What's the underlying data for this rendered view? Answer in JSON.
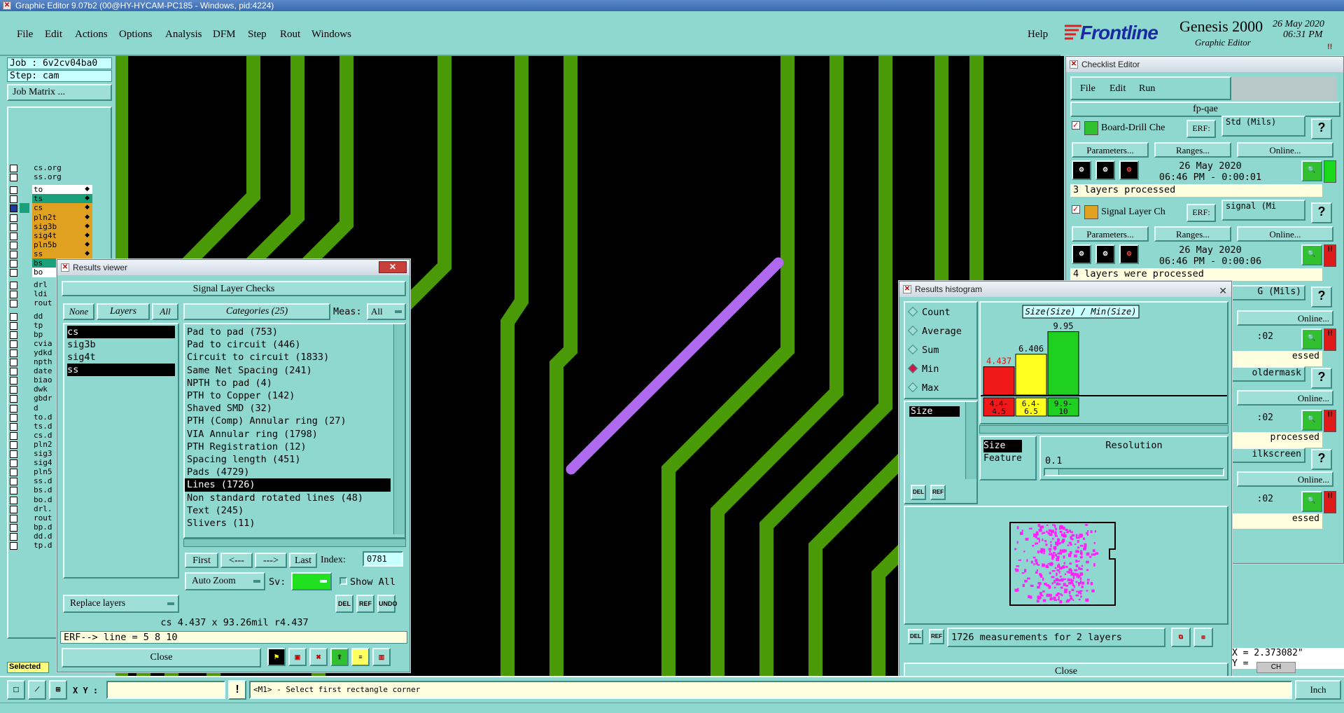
{
  "app": {
    "title": "Graphic Editor 9.07b2 (00@HY-HYCAM-PC185 - Windows, pid:4224)",
    "menu": [
      "File",
      "Edit",
      "Actions",
      "Options",
      "Analysis",
      "DFM",
      "Step",
      "Rout",
      "Windows"
    ],
    "help": "Help",
    "brand": "Frontline",
    "product": "Genesis 2000",
    "product_sub": "Graphic Editor",
    "date": "26 May 2020",
    "time": "06:31 PM"
  },
  "left_panel": {
    "job_label": "Job : 6v2cv04ba0",
    "step_label": "Step: cam",
    "job_matrix": "Job Matrix ...",
    "layers": [
      {
        "name": "cs.org",
        "color": "#8fd8d0"
      },
      {
        "name": "ss.org",
        "color": "#8fd8d0"
      },
      {
        "name": "to",
        "color": "#ffffff"
      },
      {
        "name": "ts",
        "color": "#1aa07a"
      },
      {
        "name": "cs",
        "color": "#e0a020"
      },
      {
        "name": "pln2t",
        "color": "#e0a020"
      },
      {
        "name": "sig3b",
        "color": "#e0a020"
      },
      {
        "name": "sig4t",
        "color": "#e0a020"
      },
      {
        "name": "pln5b",
        "color": "#e0a020"
      },
      {
        "name": "ss",
        "color": "#e0a020"
      },
      {
        "name": "bs",
        "color": "#1aa07a"
      },
      {
        "name": "bo",
        "color": "#ffffff"
      },
      {
        "name": "drl",
        "color": "#8fd8d0"
      },
      {
        "name": "ldi",
        "color": "#8fd8d0"
      },
      {
        "name": "rout",
        "color": "#8fd8d0"
      },
      {
        "name": "dd",
        "color": "#8fd8d0"
      },
      {
        "name": "tp",
        "color": "#8fd8d0"
      },
      {
        "name": "bp",
        "color": "#8fd8d0"
      },
      {
        "name": "cvia",
        "color": "#8fd8d0"
      },
      {
        "name": "ydkd",
        "color": "#8fd8d0"
      },
      {
        "name": "npth",
        "color": "#8fd8d0"
      },
      {
        "name": "date",
        "color": "#8fd8d0"
      },
      {
        "name": "biao",
        "color": "#8fd8d0"
      },
      {
        "name": "dwk",
        "color": "#8fd8d0"
      },
      {
        "name": "gbdr",
        "color": "#8fd8d0"
      },
      {
        "name": "d",
        "color": "#8fd8d0"
      },
      {
        "name": "to.d",
        "color": "#8fd8d0"
      },
      {
        "name": "ts.d",
        "color": "#8fd8d0"
      },
      {
        "name": "cs.d",
        "color": "#8fd8d0"
      },
      {
        "name": "pln2",
        "color": "#8fd8d0"
      },
      {
        "name": "sig3",
        "color": "#8fd8d0"
      },
      {
        "name": "sig4",
        "color": "#8fd8d0"
      },
      {
        "name": "pln5",
        "color": "#8fd8d0"
      },
      {
        "name": "ss.d",
        "color": "#8fd8d0"
      },
      {
        "name": "bs.d",
        "color": "#8fd8d0"
      },
      {
        "name": "bo.d",
        "color": "#8fd8d0"
      },
      {
        "name": "drl.",
        "color": "#8fd8d0"
      },
      {
        "name": "rout",
        "color": "#8fd8d0"
      },
      {
        "name": "bp.d",
        "color": "#8fd8d0"
      },
      {
        "name": "dd.d",
        "color": "#8fd8d0"
      },
      {
        "name": "tp.d",
        "color": "#8fd8d0"
      }
    ],
    "selected": "Selected"
  },
  "results_viewer": {
    "title": "Results viewer",
    "header": "Signal Layer Checks",
    "none_btn": "None",
    "layers_btn": "Layers",
    "all_btn": "All",
    "layers": [
      "cs",
      "sig3b",
      "sig4t",
      "ss"
    ],
    "categories_btn": "Categories (25)",
    "meas_label": "Meas:",
    "meas_value": "All",
    "categories": [
      "Pad to pad (753)",
      "Pad to circuit (446)",
      "Circuit to circuit (1833)",
      "Same Net Spacing (241)",
      "NPTH to pad (4)",
      "PTH to Copper (142)",
      "Shaved SMD (32)",
      "PTH (Comp) Annular ring (27)",
      "VIA Annular ring (1798)",
      "PTH Registration (12)",
      "Spacing length (451)",
      "Pads (4729)",
      "Lines (1726)",
      "Non standard rotated lines (48)",
      "Text (245)",
      "Slivers (11)"
    ],
    "selected_category": "Lines (1726)",
    "first": "First",
    "prev": "<---",
    "next": "--->",
    "last": "Last",
    "index_label": "Index:",
    "index_value": "0781",
    "auto_zoom": "Auto Zoom",
    "sv_label": "Sv:",
    "show_all": "Show All",
    "replace_layers": "Replace layers",
    "del": "DEL",
    "ref": "REF",
    "undo": "UNDO",
    "status": "cs 4.437 x 93.26mil  r4.437",
    "erf": "ERF--> line = 5 8 10",
    "close": "Close"
  },
  "checklist_editor": {
    "title": "Checklist Editor",
    "menu": [
      "File",
      "Edit",
      "Run"
    ],
    "name": "fp-qae",
    "checks": [
      {
        "name": "Board-Drill Che",
        "erf": "ERF:",
        "erf_value": "Std (Mils)",
        "params": "Parameters...",
        "ranges": "Ranges...",
        "online": "Online...",
        "date": "26 May 2020",
        "time": "06:46 PM - 0:00:01",
        "status": "3 layers processed",
        "status_color": "#1ad81a"
      },
      {
        "name": "Signal Layer Ch",
        "erf": "ERF:",
        "erf_value": "signal (Mi",
        "params": "Parameters...",
        "ranges": "Ranges...",
        "online": "Online...",
        "date": "26 May 2020",
        "time": "06:46 PM - 0:00:06",
        "status": "4 layers were processed",
        "status_color": "#e01a1a"
      }
    ],
    "partial": [
      "G (Mils)",
      "Online...",
      ":02",
      "essed",
      "oldermask",
      "Online...",
      ":02",
      "processed",
      "ilkscreen",
      "Online...",
      ":02",
      "essed"
    ]
  },
  "histogram": {
    "title": "Results histogram",
    "modes": [
      "Count",
      "Average",
      "Sum",
      "Min",
      "Max"
    ],
    "selected_mode": "Min",
    "chart_title": "Size(Size) / Min(Size)",
    "list_items": [
      "Size"
    ],
    "list2": [
      "Size",
      "Feature"
    ],
    "resolution_label": "Resolution",
    "resolution_value": "0.1",
    "del": "DEL",
    "ref": "REF",
    "measurements": "1726 measurements for 2 layers",
    "close": "Close"
  },
  "chart_data": {
    "type": "bar",
    "title": "Size(Size) / Min(Size)",
    "categories": [
      "4.4-4.5",
      "6.4-6.5",
      "9.9-10"
    ],
    "values": [
      4.437,
      6.406,
      9.95
    ],
    "value_labels": [
      "4.437",
      "6.406",
      "9.95"
    ],
    "category_labels": [
      [
        "4.4-",
        "4.5"
      ],
      [
        "6.4-",
        "6.5"
      ],
      [
        "9.9-",
        "10"
      ]
    ],
    "colors": [
      "#f01818",
      "#ffff20",
      "#20d020"
    ],
    "label_colors": [
      "#e01010",
      "#000000",
      "#000000"
    ],
    "ylim": [
      0,
      11
    ]
  },
  "bottom": {
    "xy_label": "X Y :",
    "xy_value": "",
    "prompt": "<M1> - Select first rectangle corner",
    "units": "Inch",
    "coord_x": "X = 2.373082\"",
    "coord_y": "Y = ",
    "ime": "CH"
  },
  "colors": {
    "trace": "#4a9a08",
    "highlight": "#b06af0",
    "bg": "#8fd8d0"
  }
}
